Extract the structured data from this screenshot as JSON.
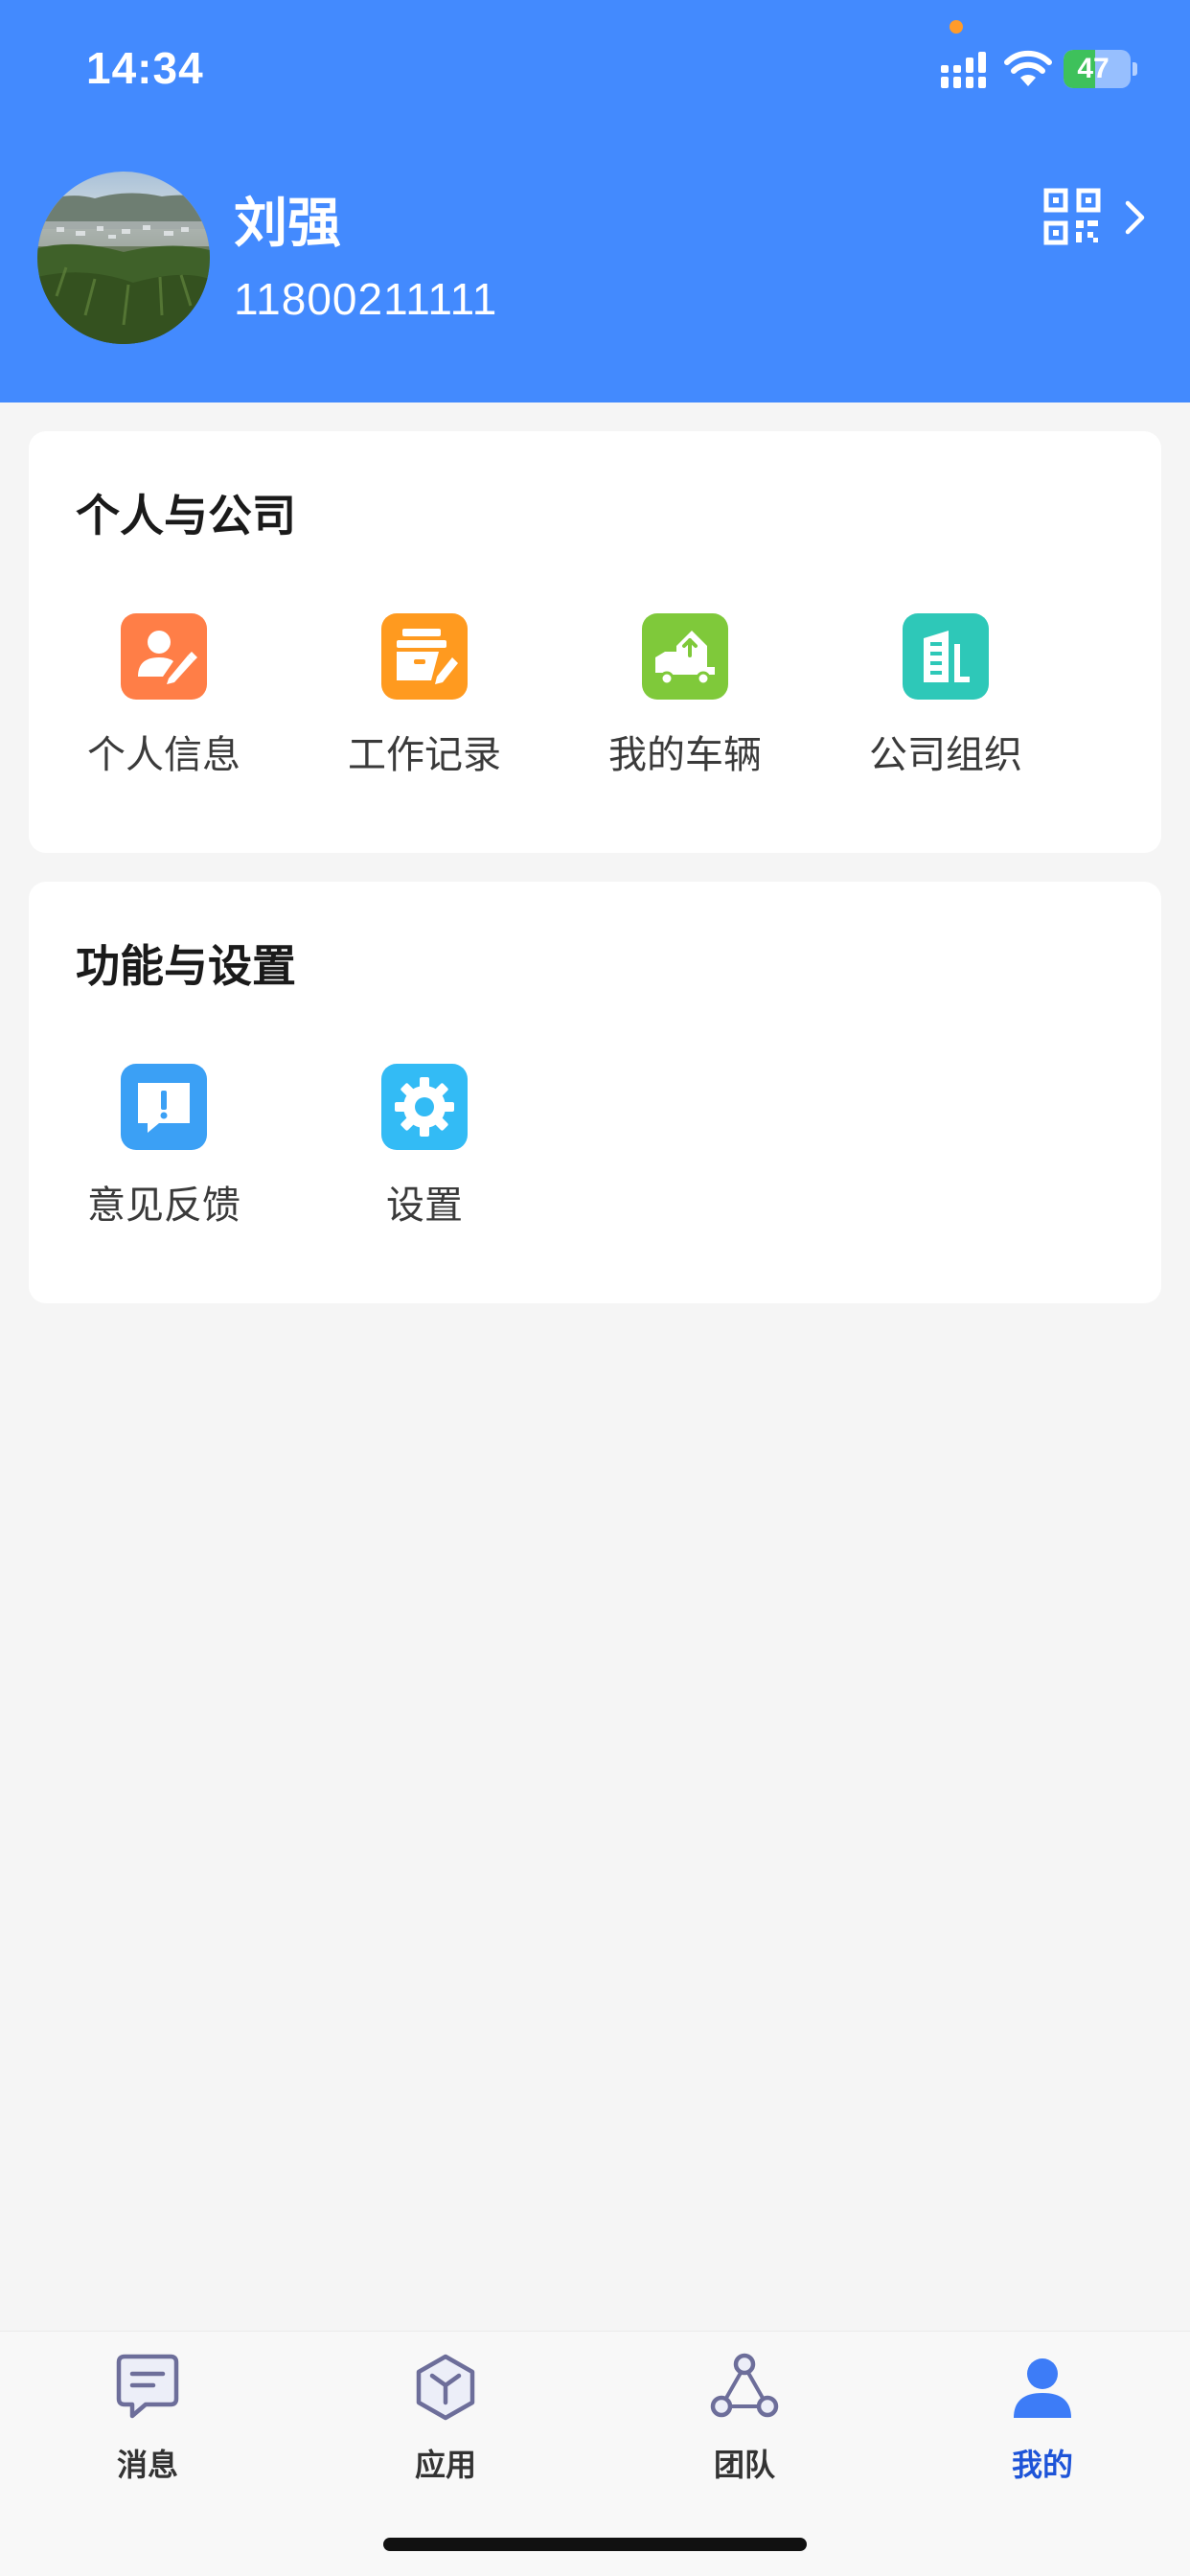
{
  "status_bar": {
    "time": "14:34",
    "battery": "47",
    "battery_level": 0.47
  },
  "profile": {
    "name": "刘强",
    "phone": "11800211111"
  },
  "sections": [
    {
      "title": "个人与公司",
      "items": [
        {
          "label": "个人信息",
          "icon": "personal-info-icon",
          "color": "#ff7e47"
        },
        {
          "label": "工作记录",
          "icon": "work-record-icon",
          "color": "#ff9a1f"
        },
        {
          "label": "我的车辆",
          "icon": "vehicle-icon",
          "color": "#7fc93a"
        },
        {
          "label": "公司组织",
          "icon": "company-icon",
          "color": "#2ec8b8"
        }
      ]
    },
    {
      "title": "功能与设置",
      "items": [
        {
          "label": "意见反馈",
          "icon": "feedback-icon",
          "color": "#3ba0f5"
        },
        {
          "label": "设置",
          "icon": "settings-gear-icon",
          "color": "#33bbf5"
        }
      ]
    }
  ],
  "tabbar": {
    "tabs": [
      {
        "label": "消息",
        "icon": "message-icon",
        "active": false
      },
      {
        "label": "应用",
        "icon": "apps-cube-icon",
        "active": false
      },
      {
        "label": "团队",
        "icon": "team-icon",
        "active": false
      },
      {
        "label": "我的",
        "icon": "profile-person-icon",
        "active": true
      }
    ],
    "active_color": "#1e54d8",
    "inactive_color": "#333333"
  },
  "theme": {
    "header_bg": "#438afe",
    "page_bg": "#f5f5f5"
  }
}
